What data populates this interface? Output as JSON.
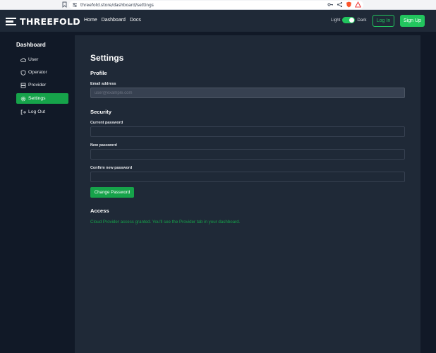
{
  "browser": {
    "url": "threefold.store/dashboard/settings",
    "icons": [
      "bookmark-icon",
      "site-settings-icon",
      "key-icon",
      "share-icon",
      "brave-shield-icon",
      "triangle-icon"
    ]
  },
  "header": {
    "logo_text": "THREEFOLD",
    "nav": {
      "home": "Home",
      "dashboard": "Dashboard",
      "docs": "Docs"
    },
    "theme": {
      "light": "Light",
      "dark": "Dark",
      "dark_enabled": true
    },
    "login_label": "Log In",
    "signup_label": "Sign Up",
    "accent": "#22c55e"
  },
  "sidebar": {
    "title": "Dashboard",
    "items": [
      {
        "label": "User",
        "icon": "cloud-icon"
      },
      {
        "label": "Operator",
        "icon": "shield-icon"
      },
      {
        "label": "Provider",
        "icon": "server-icon"
      },
      {
        "label": "Settings",
        "icon": "gear-icon",
        "active": true
      },
      {
        "label": "Log Out",
        "icon": "logout-icon"
      }
    ]
  },
  "main": {
    "title": "Settings",
    "profile": {
      "heading": "Profile",
      "email_label": "Email address",
      "email_placeholder": "user@example.com",
      "email_value": ""
    },
    "security": {
      "heading": "Security",
      "current_label": "Current password",
      "new_label": "New password",
      "confirm_label": "Confirm new password",
      "change_button": "Change Password"
    },
    "access": {
      "heading": "Access",
      "message": "Cloud Provider access granted. You'll see the Provider tab in your dashboard."
    }
  }
}
